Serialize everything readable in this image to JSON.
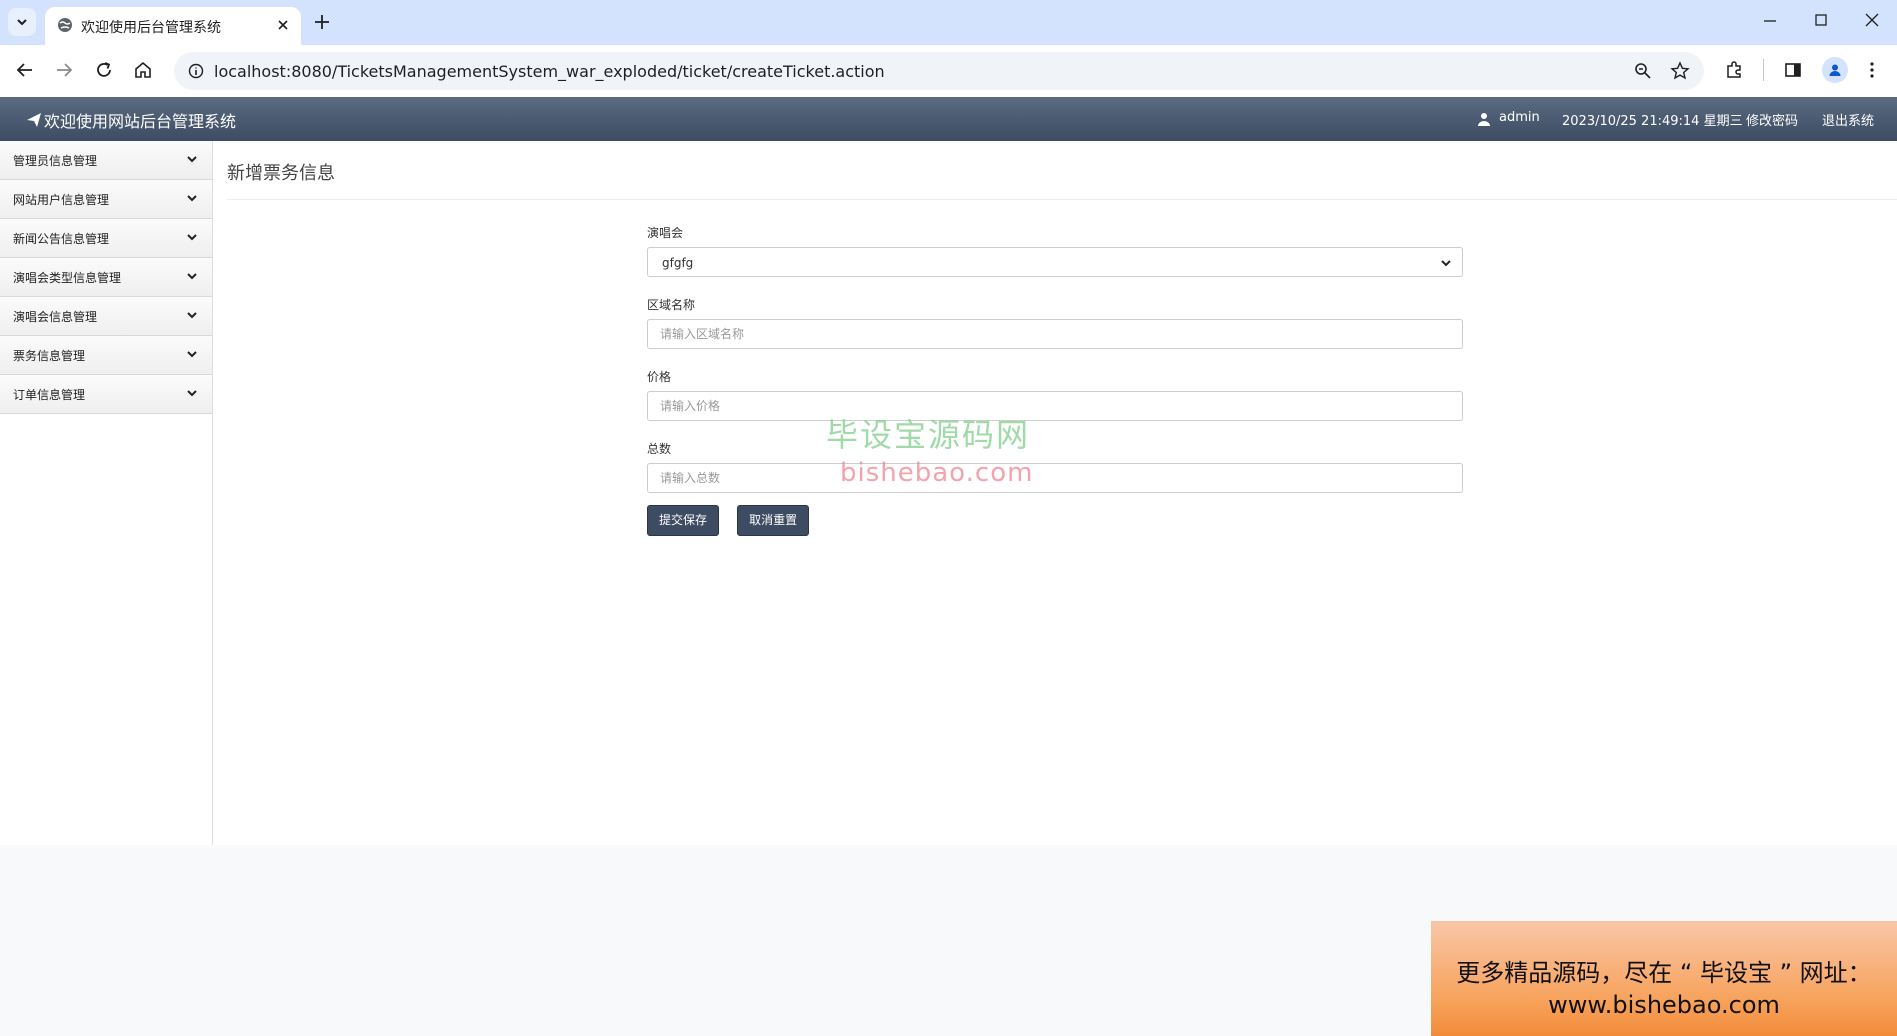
{
  "browser": {
    "tab_title": "欢迎使用后台管理系统",
    "url": "localhost:8080/TicketsManagementSystem_war_exploded/ticket/createTicket.action"
  },
  "header": {
    "brand": "欢迎使用网站后台管理系统",
    "user": "admin",
    "datetime": "2023/10/25 21:49:14 星期三",
    "change_password": "修改密码",
    "logout": "退出系统"
  },
  "sidebar": {
    "items": [
      {
        "label": "管理员信息管理"
      },
      {
        "label": "网站用户信息管理"
      },
      {
        "label": "新闻公告信息管理"
      },
      {
        "label": "演唱会类型信息管理"
      },
      {
        "label": "演唱会信息管理"
      },
      {
        "label": "票务信息管理"
      },
      {
        "label": "订单信息管理"
      }
    ]
  },
  "main": {
    "title": "新增票务信息",
    "form": {
      "concert_label": "演唱会",
      "concert_value": "gfgfg",
      "area_label": "区域名称",
      "area_placeholder": "请输入区域名称",
      "price_label": "价格",
      "price_placeholder": "请输入价格",
      "total_label": "总数",
      "total_placeholder": "请输入总数",
      "submit_label": "提交保存",
      "reset_label": "取消重置"
    }
  },
  "watermark": {
    "cn": "毕设宝源码网",
    "en": "bishebao.com",
    "promo_line1": "更多精品源码，尽在 “ 毕设宝 ” 网址：",
    "promo_line2": "www.bishebao.com"
  },
  "colors": {
    "header_bg": "#4a596e",
    "button_bg": "#3d4c62",
    "chrome_tabstrip": "#d3e3fd"
  }
}
